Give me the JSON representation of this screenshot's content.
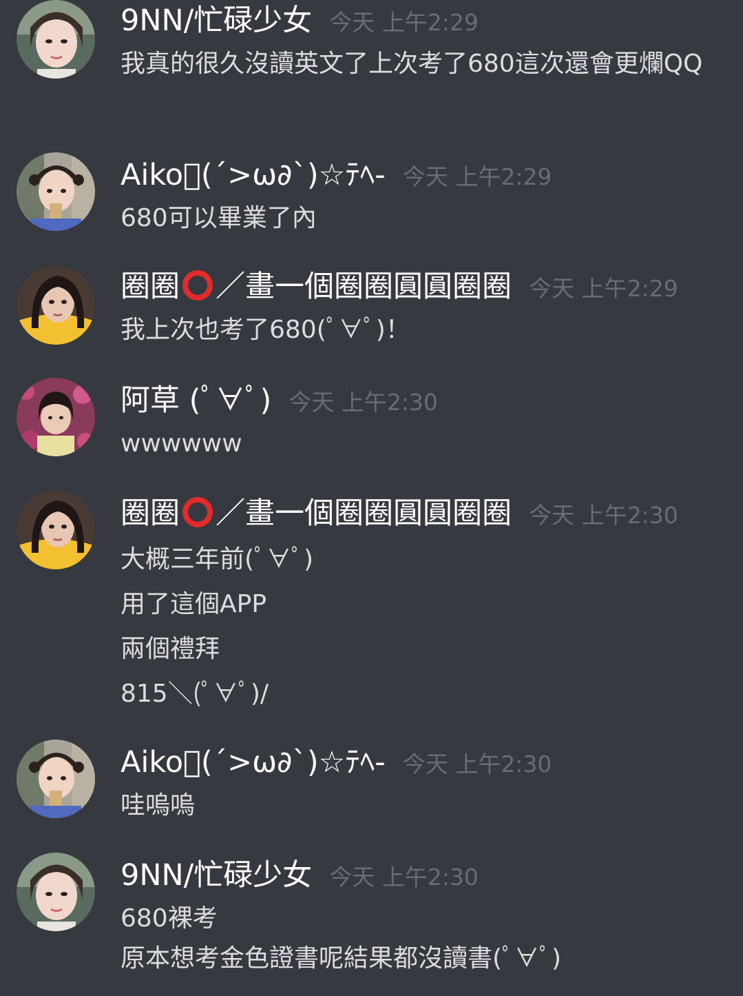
{
  "messages": [
    {
      "username": "9NN/忙碌少女",
      "timestamp": "今天 上午2:29",
      "avatar_icon": "user-avatar",
      "lines": [
        "我真的很久沒讀英文了上次考了680這次還會更爛QQ"
      ]
    },
    {
      "username": "Aiko\u0000(´>ω∂`)☆ﾃﾍ-",
      "timestamp": "今天 上午2:29",
      "avatar_icon": "user-avatar",
      "lines": [
        "680可以畢業了內"
      ]
    },
    {
      "username_pre": "圈圈",
      "username_post": "／畫一個圈圈圓圓圈圈",
      "timestamp": "今天 上午2:29",
      "avatar_icon": "user-avatar",
      "lines": [
        "我上次也考了680(ﾟ∀ﾟ)！"
      ]
    },
    {
      "username": "阿草 (ﾟ∀ﾟ)",
      "timestamp": "今天 上午2:30",
      "avatar_icon": "user-avatar",
      "lines": [
        "wwwwww"
      ]
    },
    {
      "username_pre": "圈圈",
      "username_post": "／畫一個圈圈圓圓圈圈",
      "timestamp": "今天 上午2:30",
      "avatar_icon": "user-avatar",
      "lines": [
        "大概三年前(ﾟ∀ﾟ)",
        "用了這個APP",
        "兩個禮拜",
        "815＼(ﾟ∀ﾟ)/"
      ]
    },
    {
      "username": "Aiko\u0000(´>ω∂`)☆ﾃﾍ-",
      "timestamp": "今天 上午2:30",
      "avatar_icon": "user-avatar",
      "lines": [
        "哇嗚嗚"
      ]
    },
    {
      "username": "9NN/忙碌少女",
      "timestamp": "今天 上午2:30",
      "avatar_icon": "user-avatar",
      "lines": [
        "680裸考",
        "原本想考金色證書呢結果都沒讀書(ﾟ∀ﾟ)"
      ]
    }
  ],
  "colors": {
    "background": "#36393f",
    "username": "#ffffff",
    "timestamp": "#696c72",
    "text": "#dcddde",
    "ring": "#e32b2b"
  }
}
